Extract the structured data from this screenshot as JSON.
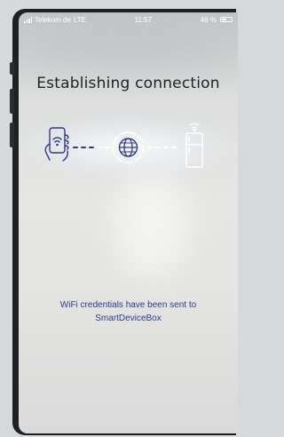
{
  "status_bar": {
    "carrier": "Telekom.de",
    "network": "LTE",
    "time": "11:57",
    "battery": "46 %"
  },
  "screen": {
    "title": "Establishing connection",
    "message": "WiFi credentials have been sent to\nSmartDeviceBox"
  },
  "icons": [
    "phone-hand-icon",
    "globe-icon",
    "fridge-wifi-icon"
  ],
  "colors": {
    "accent": "#2d3a8c",
    "title": "#1f2226"
  }
}
